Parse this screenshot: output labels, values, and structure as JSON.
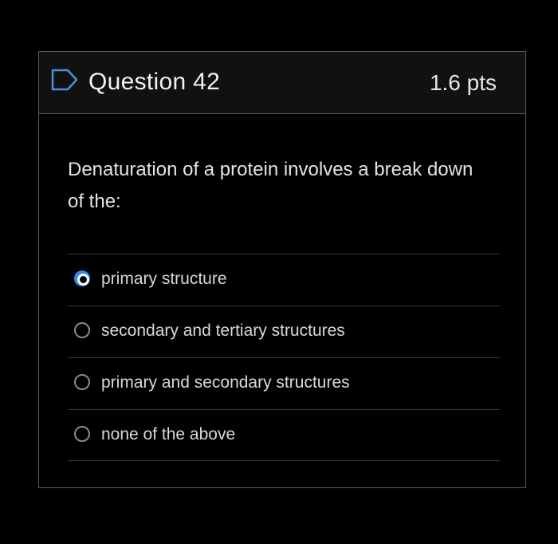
{
  "question": {
    "title": "Question 42",
    "points": "1.6 pts",
    "flag_icon": "flag-outline-icon",
    "text": "Denaturation of a protein involves a break down of the:"
  },
  "answers": [
    {
      "label": "primary structure",
      "selected": true
    },
    {
      "label": "secondary and tertiary structures",
      "selected": false
    },
    {
      "label": "primary and secondary structures",
      "selected": false
    },
    {
      "label": "none of the above",
      "selected": false
    }
  ],
  "colors": {
    "background": "#000000",
    "header_bg": "#111111",
    "border": "#5a5a5a",
    "accent": "#2f8cf0",
    "flag_outline": "#4a90d9"
  }
}
